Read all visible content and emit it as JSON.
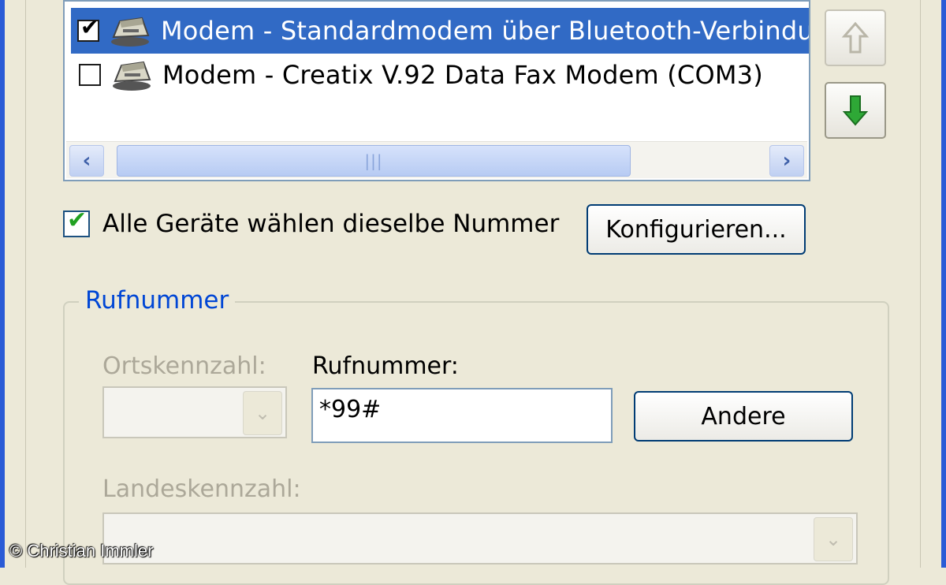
{
  "devices": {
    "items": [
      {
        "label": "Modem - Standardmodem über Bluetooth-Verbindung",
        "checked": true,
        "selected": true,
        "icon": "modem-icon"
      },
      {
        "label": "Modem - Creatix V.92 Data Fax Modem (COM3)",
        "checked": false,
        "selected": false,
        "icon": "modem-icon"
      }
    ],
    "scroll_thumb_glyph": "|||"
  },
  "controls": {
    "move_up_icon": "arrow-up-icon",
    "move_down_icon": "arrow-down-icon"
  },
  "options": {
    "all_devices_same_number_label": "Alle Geräte wählen dieselbe Nummer",
    "all_devices_same_number_checked": true,
    "configure_button_label": "Konfigurieren..."
  },
  "phone_group": {
    "title": "Rufnummer",
    "area_code_label": "Ortskennzahl:",
    "area_code_value": "",
    "phone_label": "Rufnummer:",
    "phone_value": "*99#",
    "other_button_label": "Andere",
    "country_code_label": "Landeskennzahl:",
    "country_code_value": ""
  },
  "credit": "© Christian Immler",
  "colors": {
    "selection": "#316ac5",
    "group_title": "#0046d5",
    "xp_blue_border": "#2a5bd6",
    "check_green": "#21a121"
  }
}
